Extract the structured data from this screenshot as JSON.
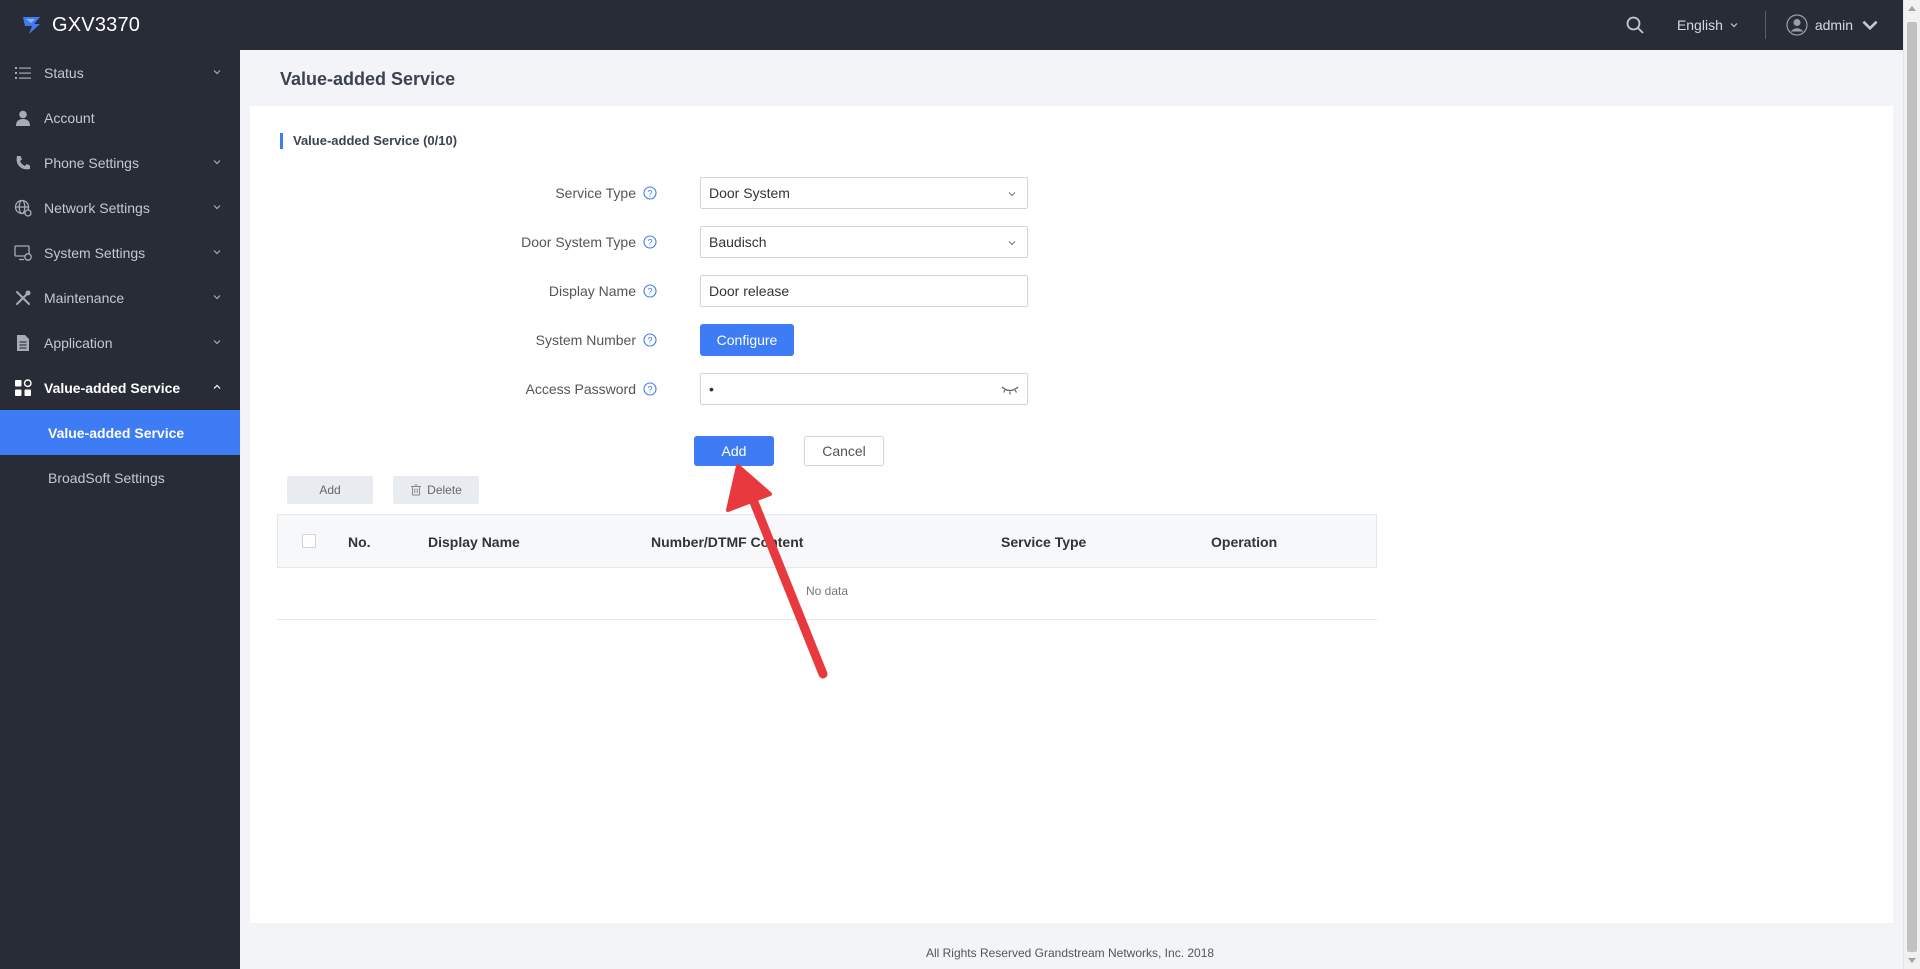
{
  "app": {
    "name": "GXV3370"
  },
  "topbar": {
    "language": "English",
    "user": "admin"
  },
  "sidebar": {
    "items": [
      {
        "label": "Status",
        "icon": "list-icon",
        "expandable": true
      },
      {
        "label": "Account",
        "icon": "user-icon",
        "expandable": false
      },
      {
        "label": "Phone Settings",
        "icon": "phone-icon",
        "expandable": true
      },
      {
        "label": "Network Settings",
        "icon": "network-icon",
        "expandable": true
      },
      {
        "label": "System Settings",
        "icon": "monitor-gear-icon",
        "expandable": true
      },
      {
        "label": "Maintenance",
        "icon": "tools-icon",
        "expandable": true
      },
      {
        "label": "Application",
        "icon": "document-icon",
        "expandable": true
      },
      {
        "label": "Value-added Service",
        "icon": "grid-icon",
        "expandable": true,
        "open": true
      }
    ],
    "subitems": [
      {
        "label": "Value-added Service",
        "active": true
      },
      {
        "label": "BroadSoft Settings",
        "active": false
      }
    ]
  },
  "main": {
    "page_title": "Value-added Service",
    "section_title": "Value-added Service (0/10)",
    "form": {
      "service_type": {
        "label": "Service Type",
        "value": "Door System"
      },
      "door_system_type": {
        "label": "Door System Type",
        "value": "Baudisch"
      },
      "display_name": {
        "label": "Display Name",
        "value": "Door release"
      },
      "system_number": {
        "label": "System Number",
        "button": "Configure"
      },
      "access_password": {
        "label": "Access Password",
        "value": "•"
      }
    },
    "actions": {
      "add": "Add",
      "cancel": "Cancel"
    },
    "toolbar": {
      "add": "Add",
      "delete": "Delete"
    },
    "table": {
      "columns": [
        "No.",
        "Display Name",
        "Number/DTMF Content",
        "Service Type",
        "Operation"
      ],
      "empty_text": "No data"
    }
  },
  "footer": {
    "text": "All Rights Reserved Grandstream Networks, Inc. 2018"
  },
  "colors": {
    "accent": "#3d7cf5",
    "sidebar_bg": "#282c37",
    "annotation_arrow": "#e8393f"
  }
}
